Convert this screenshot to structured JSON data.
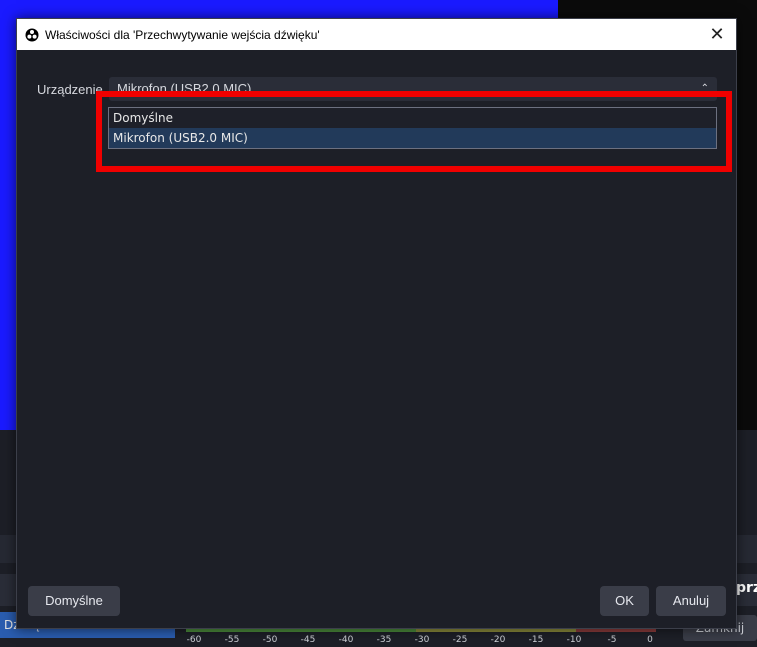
{
  "background": {
    "audio_source_label": "Dźwięk",
    "right_label": "prz",
    "right_button": "Zamknij",
    "meter_ticks": [
      "-60",
      "-55",
      "-50",
      "-45",
      "-40",
      "-35",
      "-30",
      "-25",
      "-20",
      "-15",
      "-10",
      "-5",
      "0"
    ]
  },
  "dialog": {
    "title": "Właściwości dla 'Przechwytywanie wejścia dźwięku'",
    "device_label": "Urządzenie",
    "device_value": "Mikrofon (USB2.0 MIC)",
    "dropdown_options": [
      "Domyślne",
      "Mikrofon (USB2.0 MIC)"
    ],
    "selected_option_index": 1,
    "buttons": {
      "defaults": "Domyślne",
      "ok": "OK",
      "cancel": "Anuluj"
    }
  },
  "colors": {
    "highlight": "#f00000",
    "accent_selected": "#223a5a"
  }
}
